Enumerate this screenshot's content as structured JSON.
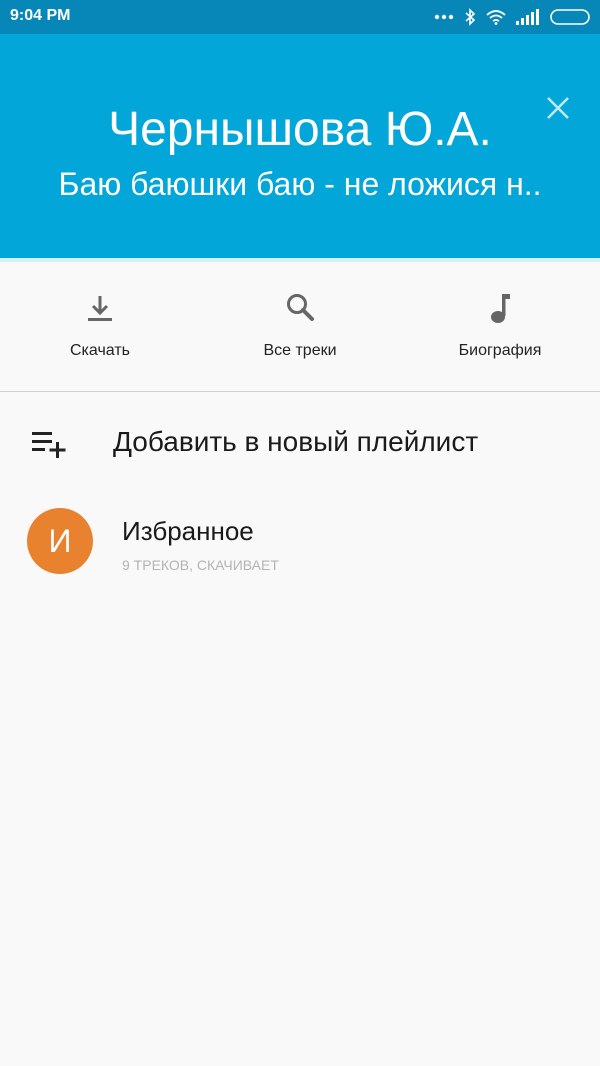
{
  "status_bar": {
    "time": "9:04 PM",
    "icons": [
      "more-dots-icon",
      "bluetooth-icon",
      "wifi-icon",
      "signal-icon",
      "battery-icon"
    ]
  },
  "header": {
    "artist": "Чернышова Ю.А.",
    "song": "Баю баюшки баю - не ложися н..",
    "close_icon": "close-icon",
    "background": "#02a6d9"
  },
  "actions": [
    {
      "label": "Скачать",
      "icon": "download-icon"
    },
    {
      "label": "Все треки",
      "icon": "search-icon"
    },
    {
      "label": "Биография",
      "icon": "music-note-icon"
    }
  ],
  "new_playlist": {
    "label": "Добавить в новый плейлист",
    "icon": "playlist-add-icon"
  },
  "playlists": [
    {
      "initial": "И",
      "title": "Избранное",
      "subtitle": "9 ТРЕКОВ, СКАЧИВАЕТ",
      "color": "#e8822e"
    }
  ]
}
